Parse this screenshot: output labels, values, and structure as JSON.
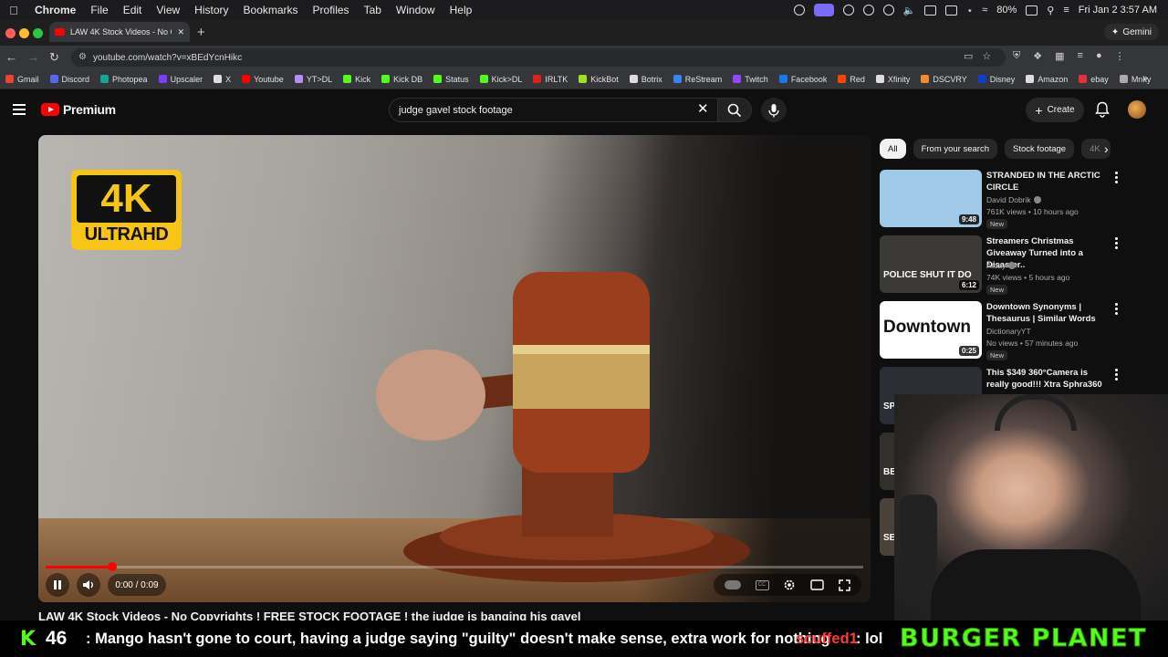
{
  "menubar": {
    "app": "Chrome",
    "items": [
      "File",
      "Edit",
      "View",
      "History",
      "Bookmarks",
      "Profiles",
      "Tab",
      "Window",
      "Help"
    ],
    "battery": "80%",
    "datetime": "Fri Jan 2  3:57 AM"
  },
  "browser": {
    "tab_title": "LAW 4K Stock Videos - No Co",
    "url": "youtube.com/watch?v=xBEdYcnHikc",
    "gemini_label": "Gemini"
  },
  "bookmarks": [
    {
      "label": "Gmail",
      "color": "#ea4335"
    },
    {
      "label": "Discord",
      "color": "#5865f2"
    },
    {
      "label": "Photopea",
      "color": "#18a497"
    },
    {
      "label": "Upscaler",
      "color": "#7a3cff"
    },
    {
      "label": "X",
      "color": "#dddddd"
    },
    {
      "label": "Youtube",
      "color": "#ff0000"
    },
    {
      "label": "YT>DL",
      "color": "#b48cff"
    },
    {
      "label": "Kick",
      "color": "#53fc18"
    },
    {
      "label": "Kick DB",
      "color": "#53fc18"
    },
    {
      "label": "Status",
      "color": "#53fc18"
    },
    {
      "label": "Kick>DL",
      "color": "#53fc18"
    },
    {
      "label": "IRLTK",
      "color": "#e02020"
    },
    {
      "label": "KickBot",
      "color": "#a0e020"
    },
    {
      "label": "Botrix",
      "color": "#dddddd"
    },
    {
      "label": "ReStream",
      "color": "#3b82f6"
    },
    {
      "label": "Twitch",
      "color": "#9146ff"
    },
    {
      "label": "Facebook",
      "color": "#1877f2"
    },
    {
      "label": "Red",
      "color": "#ff4500"
    },
    {
      "label": "Xfinity",
      "color": "#dddddd"
    },
    {
      "label": "DSCVRY",
      "color": "#f28c28"
    },
    {
      "label": "Disney",
      "color": "#113ccf"
    },
    {
      "label": "Amazon",
      "color": "#dddddd"
    },
    {
      "label": "ebay",
      "color": "#e53238"
    },
    {
      "label": "Mnky",
      "color": "#aaaaaa"
    }
  ],
  "youtube": {
    "logo_text": "Premium",
    "search_query": "judge gavel stock footage",
    "create_label": "Create"
  },
  "player": {
    "badge_main": "4K",
    "badge_sub": "ULTRAHD",
    "time": "0:00 / 0:09",
    "progress_fraction": 0.082,
    "title": "LAW 4K Stock Videos - No Copyrights ! FREE STOCK FOOTAGE ! the judge is banging his gavel"
  },
  "chips": [
    "All",
    "From your search",
    "Stock footage",
    "4K"
  ],
  "recommendations": [
    {
      "title": "STRANDED IN THE ARCTIC CIRCLE",
      "channel": "David Dobrik",
      "verified": true,
      "meta": "761K views • 10 hours ago",
      "badge": "New",
      "duration": "9:48",
      "thumb_color": "#9fc9e6"
    },
    {
      "title": "Streamers Christmas Giveaway Turned into a Disaster..",
      "channel": "Atozy",
      "verified": true,
      "meta": "74K views • 5 hours ago",
      "badge": "New",
      "duration": "6:12",
      "thumb_text": "POLICE SHUT IT DO",
      "thumb_color": "#3c3a36"
    },
    {
      "title": "Downtown Synonyms | Thesaurus | Similar Words",
      "channel": "DictionaryYT",
      "verified": false,
      "meta": "No views • 57 minutes ago",
      "badge": "New",
      "duration": "0:25",
      "thumb_text": "Downtown",
      "thumb_color": "#ffffff"
    },
    {
      "title": "This $349 360°Camera is really good!!! Xtra Sphra360",
      "channel": "",
      "verified": false,
      "meta": "",
      "badge": "",
      "duration": "9:3",
      "thumb_text": "SPHRA 360",
      "thumb_color": "#2a2d33"
    },
    {
      "title": "ail ! Prison | Free | ...",
      "channel": "",
      "verified": false,
      "meta": "",
      "badge": "",
      "duration": "5:16",
      "thumb_text": "BEHIND THE BARS",
      "thumb_color": "#33302c"
    },
    {
      "title": "ear",
      "channel": "",
      "verified": false,
      "meta": "",
      "badge": "",
      "duration": "",
      "thumb_text": "SEEING THE W",
      "thumb_color": "#4a4238"
    }
  ],
  "overlay": {
    "viewer_count": "46",
    "chat_message": ": Mango hasn't gone to court, having a judge saying \"guilty\" doesn't make sense, extra work for nothing",
    "chat_user": "scuffed1",
    "chat_message2": ": lol",
    "brand": "BURGER PLANET"
  }
}
